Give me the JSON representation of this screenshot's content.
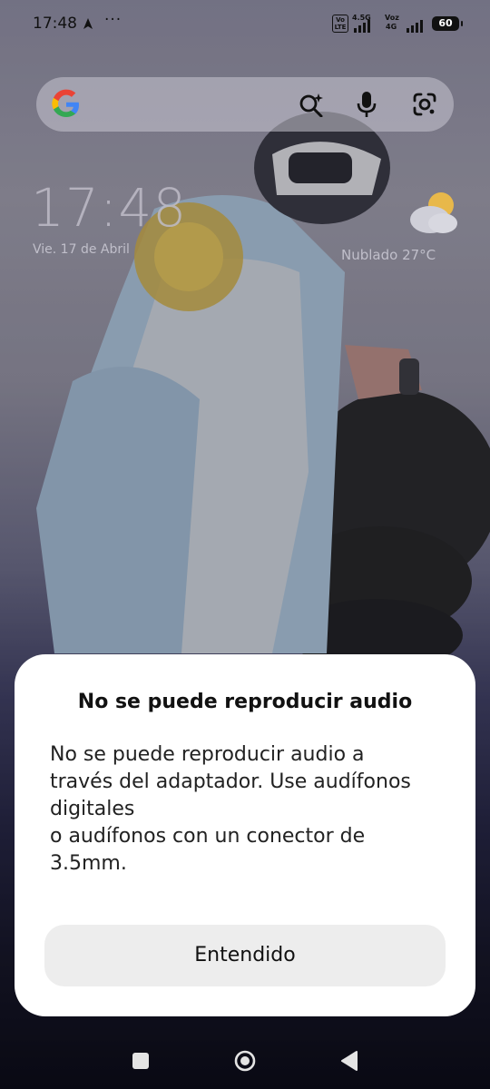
{
  "status_bar": {
    "time": "17:48",
    "more": "···",
    "volte": "Vo\nLTE",
    "sim1_tech": "4.5G",
    "sim2_tech_top": "Voz",
    "sim2_tech_bottom": "4G",
    "battery": "60"
  },
  "search_widget": {
    "logo": "google-g-logo",
    "icons": [
      "ai-search-icon",
      "microphone-icon",
      "google-lens-icon"
    ]
  },
  "lock_widget": {
    "time": "17:48",
    "date": "Vie. 17 de Abril",
    "weather": "Nublado  27°C"
  },
  "dialog": {
    "title": "No se puede reproducir audio",
    "body_lines": [
      "No se puede reproducir audio a",
      "través del adaptador. Use audífonos",
      "digitales",
      "o audífonos con un conector de",
      "3.5mm."
    ],
    "button_label": "Entendido"
  },
  "nav_bar": {
    "icons": [
      "recents-square-icon",
      "home-circle-icon",
      "back-triangle-icon"
    ]
  },
  "colors": {
    "dialog_bg": "#ffffff",
    "button_bg": "#ededed",
    "nav_icon": "#e4e4e4"
  }
}
